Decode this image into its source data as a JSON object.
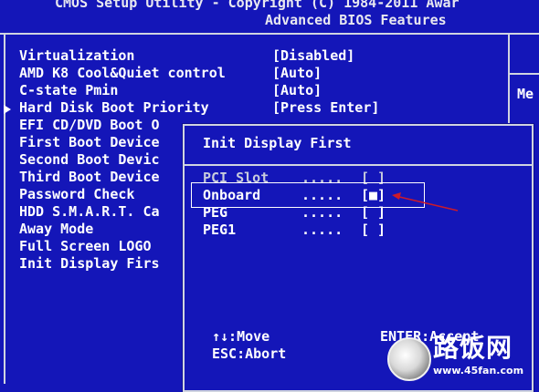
{
  "header": {
    "line1": "CMOS Setup Utility - Copyright (C) 1984-2011 Awar",
    "line2": "Advanced BIOS Features"
  },
  "menu": {
    "items": [
      {
        "label": "Virtualization"
      },
      {
        "label": "AMD K8 Cool&Quiet control"
      },
      {
        "label": "C-state Pmin"
      },
      {
        "label": "Hard Disk Boot Priority"
      },
      {
        "label": "EFI CD/DVD Boot O"
      },
      {
        "label": "First Boot Device"
      },
      {
        "label": "Second Boot Devic"
      },
      {
        "label": "Third Boot Device"
      },
      {
        "label": "Password Check"
      },
      {
        "label": "HDD S.M.A.R.T. Ca"
      },
      {
        "label": "Away Mode"
      },
      {
        "label": "Full Screen LOGO"
      },
      {
        "label": "Init Display Firs"
      }
    ],
    "values": [
      "[Disabled]",
      "[Auto]",
      "[Auto]",
      "[Press Enter]"
    ]
  },
  "help_panel": {
    "label": "Me"
  },
  "popup": {
    "title": "Init Display First",
    "options": [
      {
        "name": "PCI Slot",
        "dots": ".....",
        "box": "[ ]"
      },
      {
        "name": "Onboard",
        "dots": ".....",
        "box": "[■]"
      },
      {
        "name": "PEG",
        "dots": ".....",
        "box": "[ ]"
      },
      {
        "name": "PEG1",
        "dots": ".....",
        "box": "[ ]"
      }
    ],
    "selected": "Onboard",
    "help": {
      "move": "↑↓:Move",
      "abort": "ESC:Abort",
      "enter": "ENTER:Accept"
    }
  },
  "watermark": {
    "text": "路饭网",
    "url": "www.45fan.com"
  },
  "colors": {
    "background": "#1416b8",
    "text": "#ffffff",
    "border": "#d0d4e0",
    "arrow": "#cc1a2a"
  }
}
